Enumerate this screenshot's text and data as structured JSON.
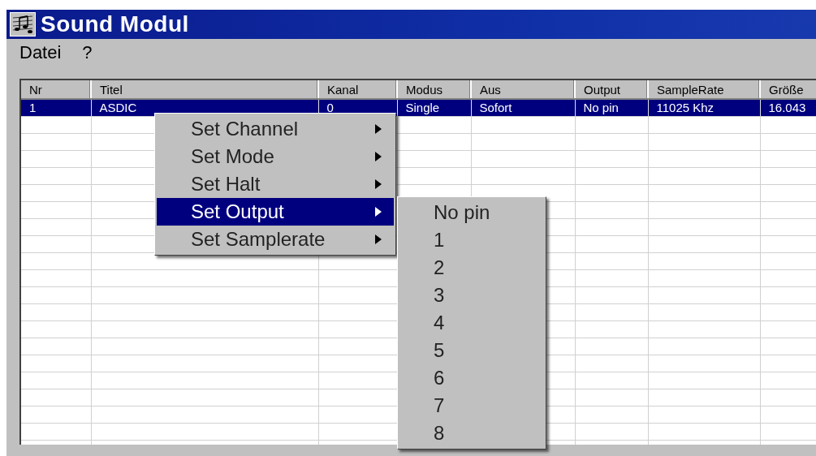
{
  "window": {
    "title": "Sound Modul"
  },
  "menu_bar": [
    "Datei",
    "?"
  ],
  "table": {
    "columns": [
      "Nr",
      "Titel",
      "Kanal",
      "Modus",
      "Aus",
      "Output",
      "SampleRate",
      "Größe"
    ],
    "rows": [
      {
        "cells": [
          "1",
          "ASDIC",
          "0",
          "Single",
          "Sofort",
          "No pin",
          "11025 Khz",
          "16.043"
        ],
        "selected": true
      }
    ]
  },
  "context_menu": {
    "items": [
      {
        "label": "Set Channel",
        "selected": false
      },
      {
        "label": "Set Mode",
        "selected": false
      },
      {
        "label": "Set Halt",
        "selected": false
      },
      {
        "label": "Set Output",
        "selected": true
      },
      {
        "label": "Set Samplerate",
        "selected": false
      }
    ]
  },
  "submenu": {
    "items": [
      {
        "label": "No pin",
        "selected": false
      },
      {
        "label": "1",
        "selected": false
      },
      {
        "label": "2",
        "selected": false
      },
      {
        "label": "3",
        "selected": false
      },
      {
        "label": "4",
        "selected": false
      },
      {
        "label": "5",
        "selected": false
      },
      {
        "label": "6",
        "selected": false
      },
      {
        "label": "7",
        "selected": false
      },
      {
        "label": "8",
        "selected": false
      }
    ]
  }
}
